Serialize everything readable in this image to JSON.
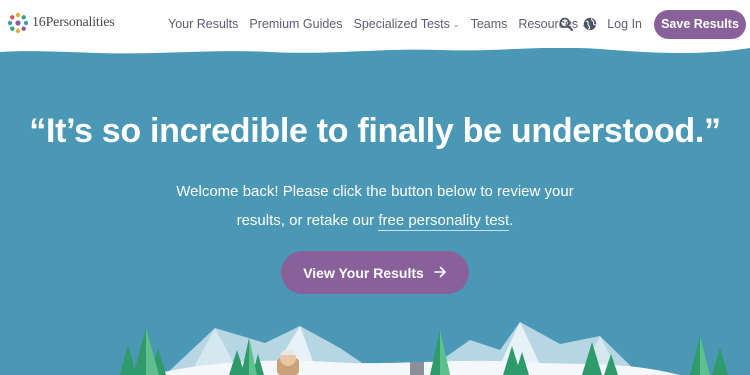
{
  "brand": {
    "name": "16Personalities",
    "accent": "#88619a",
    "hero_bg": "#4a98b5"
  },
  "nav": {
    "items": [
      {
        "label": "Your Results"
      },
      {
        "label": "Premium Guides"
      },
      {
        "label": "Specialized Tests",
        "has_dropdown": true
      },
      {
        "label": "Teams"
      },
      {
        "label": "Resources",
        "has_dropdown": true
      }
    ],
    "search_icon": "search-icon",
    "language_icon": "globe-icon",
    "login_label": "Log In",
    "save_results_label": "Save Results"
  },
  "hero": {
    "quote": "“It’s so incredible to finally be understood.”",
    "welcome_line1": "Welcome back! Please click the button below to review your",
    "welcome_line2_prefix": "results, or retake our ",
    "welcome_link": "free personality test",
    "welcome_line2_suffix": ".",
    "cta_label": "View Your Results",
    "cta_icon": "arrow-right-icon"
  }
}
